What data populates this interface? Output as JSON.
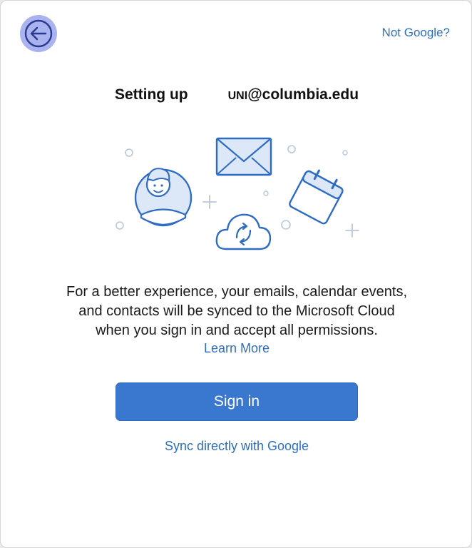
{
  "header": {
    "back_icon": "arrow-left-circle-icon",
    "not_google_label": "Not Google?"
  },
  "title": {
    "prefix": "Setting up",
    "account_user": "UNI",
    "account_domain": "@columbia.edu"
  },
  "illustration": {
    "icons": [
      "avatar-icon",
      "envelope-icon",
      "calendar-icon",
      "cloud-sync-icon"
    ]
  },
  "description": {
    "lines": [
      "For a better experience, your emails, calendar events,",
      "and contacts will be synced to the Microsoft Cloud",
      "when you sign in and accept all permissions."
    ],
    "learn_more_label": "Learn More"
  },
  "actions": {
    "sign_in_label": "Sign in",
    "sync_google_label": "Sync directly with Google"
  },
  "colors": {
    "accent": "#3a78d0",
    "link": "#2d6fbf",
    "back_button": "#a9b3f0",
    "illustration_stroke": "#2e6cc4",
    "illustration_fill": "#dce8f7"
  }
}
